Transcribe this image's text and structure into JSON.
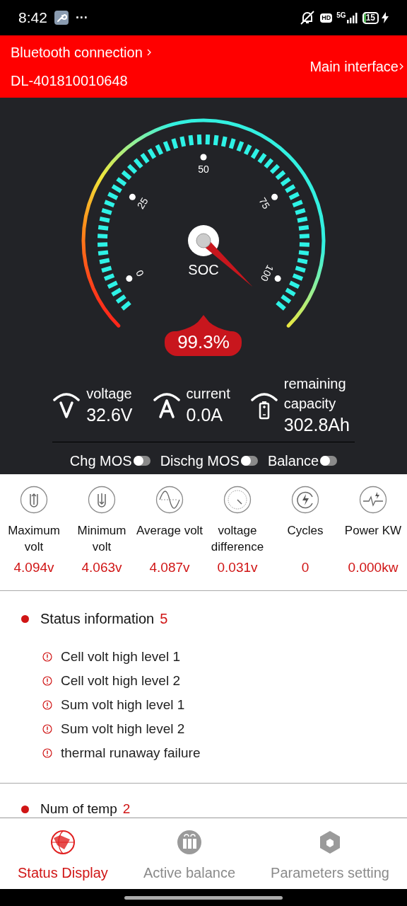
{
  "status_bar": {
    "time": "8:42",
    "more": "···",
    "hd": "HD",
    "network": "5G",
    "battery": "15"
  },
  "header": {
    "bluetooth": "Bluetooth connection",
    "device": "DL-401810010648",
    "main": "Main interface"
  },
  "gauge": {
    "label": "SOC",
    "reading": "99.3%",
    "ticks": [
      "0",
      "25",
      "50",
      "75",
      "100"
    ]
  },
  "readings": [
    {
      "kind": "voltage",
      "label": "voltage",
      "value": "32.6V"
    },
    {
      "kind": "current",
      "label": "current",
      "value": "0.0A"
    },
    {
      "kind": "capacity",
      "label": "remaining capacity",
      "value": "302.8Ah"
    }
  ],
  "switches": [
    {
      "label": "Chg MOS",
      "on": false
    },
    {
      "label": "Dischg MOS",
      "on": false
    },
    {
      "label": "Balance",
      "on": false
    }
  ],
  "metrics": [
    {
      "kind": "max",
      "label": "Maximum volt",
      "value": "4.094v"
    },
    {
      "kind": "min",
      "label": "Minimum volt",
      "value": "4.063v"
    },
    {
      "kind": "avg",
      "label": "Average volt",
      "value": "4.087v"
    },
    {
      "kind": "diff",
      "label": "voltage difference",
      "value": "0.031v"
    },
    {
      "kind": "cycles",
      "label": "Cycles",
      "value": "0"
    },
    {
      "kind": "power",
      "label": "Power KW",
      "value": "0.000kw"
    }
  ],
  "status_info": {
    "title": "Status information",
    "count": "5",
    "items": [
      "Cell volt high level 1",
      "Cell volt high level 2",
      "Sum volt high level 1",
      "Sum volt high level 2",
      "thermal runaway failure"
    ]
  },
  "temp": {
    "title": "Num of temp",
    "count": "2"
  },
  "tabs": [
    {
      "kind": "status",
      "label": "Status Display",
      "selected": true
    },
    {
      "kind": "balance",
      "label": "Active balance",
      "selected": false
    },
    {
      "kind": "params",
      "label": "Parameters setting",
      "selected": false
    }
  ]
}
